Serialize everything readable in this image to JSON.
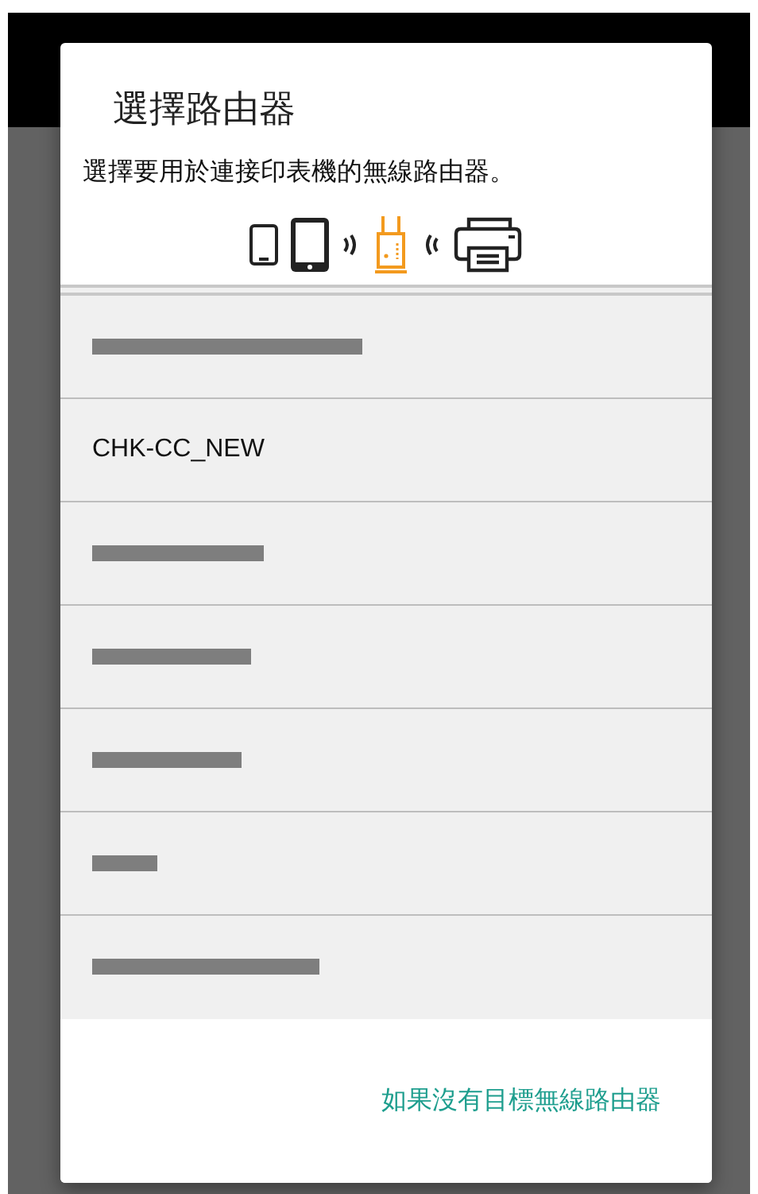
{
  "dialog": {
    "title": "選擇路由器",
    "message": "選擇要用於連接印表機的無線路由器。"
  },
  "routers": [
    {
      "kind": "redacted"
    },
    {
      "kind": "network",
      "name": "CHK-CC_NEW"
    },
    {
      "kind": "redacted"
    },
    {
      "kind": "redacted"
    },
    {
      "kind": "redacted"
    },
    {
      "kind": "redacted"
    },
    {
      "kind": "redacted"
    }
  ],
  "footer_button": "如果沒有目標無線路由器"
}
